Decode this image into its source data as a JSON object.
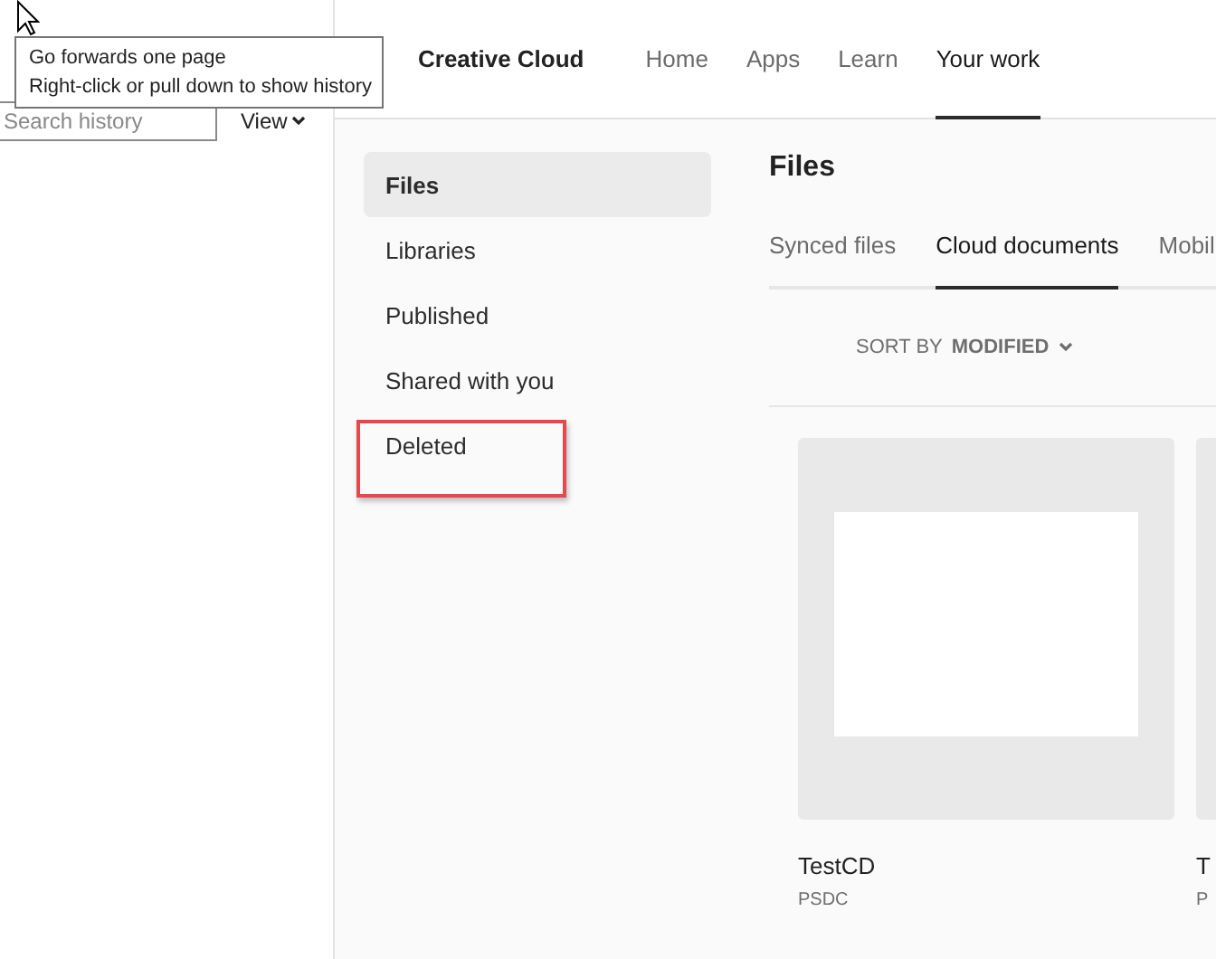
{
  "tooltip": {
    "lines": [
      "Go forwards one page",
      "Right-click or pull down to show history"
    ]
  },
  "history_panel": {
    "search": {
      "placeholder": "Search history"
    },
    "view_button": "View"
  },
  "header": {
    "brand": "Creative Cloud",
    "nav": [
      {
        "label": "Home",
        "selected": false
      },
      {
        "label": "Apps",
        "selected": false
      },
      {
        "label": "Learn",
        "selected": false
      },
      {
        "label": "Your work",
        "selected": true
      }
    ]
  },
  "sidebar": {
    "items": [
      {
        "label": "Files",
        "selected": true,
        "highlighted": false
      },
      {
        "label": "Libraries",
        "selected": false,
        "highlighted": false
      },
      {
        "label": "Published",
        "selected": false,
        "highlighted": false
      },
      {
        "label": "Shared with you",
        "selected": false,
        "highlighted": false
      },
      {
        "label": "Deleted",
        "selected": false,
        "highlighted": true
      }
    ]
  },
  "content": {
    "title": "Files",
    "tabs": [
      {
        "label": "Synced files",
        "selected": false
      },
      {
        "label": "Cloud documents",
        "selected": true
      },
      {
        "label": "Mobil",
        "selected": false
      }
    ],
    "sort": {
      "label": "SORT BY",
      "value": "MODIFIED"
    },
    "files": [
      {
        "name": "TestCD",
        "type": "PSDC"
      },
      {
        "name": "T",
        "type": "P"
      }
    ]
  }
}
